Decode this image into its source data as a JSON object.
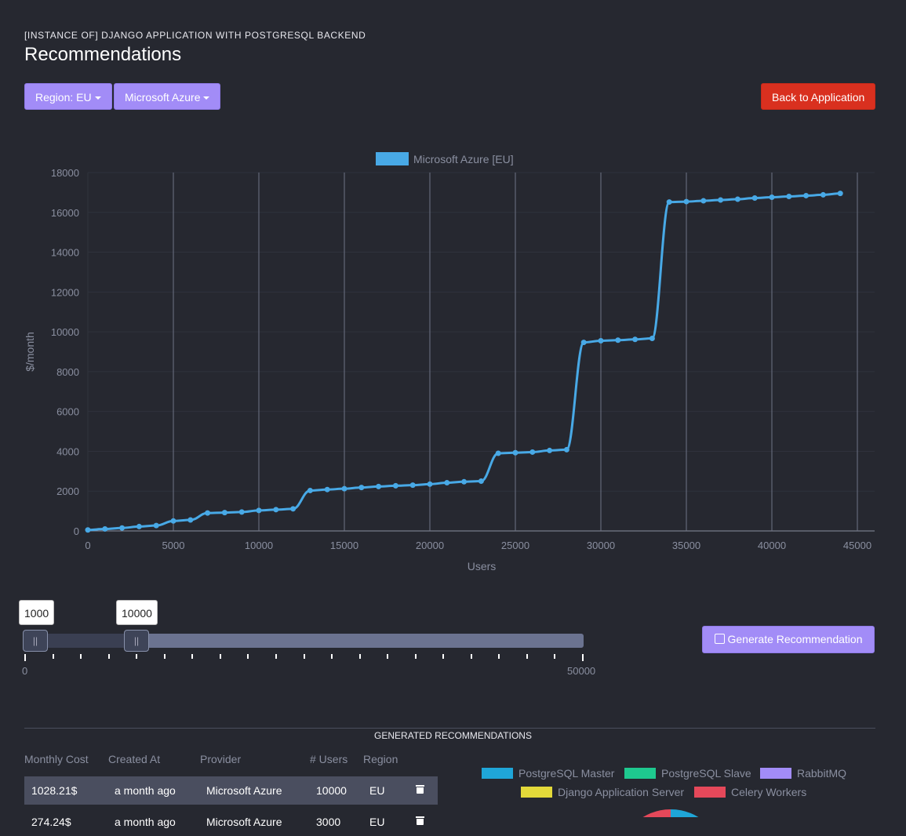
{
  "header": {
    "subtitle": "[INSTANCE OF] DJANGO APPLICATION WITH POSTGRESQL BACKEND",
    "title": "Recommendations"
  },
  "toolbar": {
    "region_label": "Region: EU",
    "provider_label": "Microsoft Azure",
    "back_label": "Back to Application"
  },
  "colors": {
    "accent_purple": "#a28cf7",
    "danger_red": "#d9301f",
    "series_blue": "#48a9e6",
    "background": "#262830"
  },
  "chart_data": {
    "type": "line",
    "legend": [
      "Microsoft Azure [EU]"
    ],
    "legend_position": "top",
    "xlabel": "Users",
    "ylabel": "$/month",
    "xlim": [
      0,
      45000
    ],
    "ylim": [
      0,
      18000
    ],
    "x_ticks": [
      "0",
      "5000",
      "10000",
      "15000",
      "20000",
      "25000",
      "30000",
      "35000",
      "40000",
      "45000"
    ],
    "y_ticks": [
      "0",
      "2000",
      "4000",
      "6000",
      "8000",
      "10000",
      "12000",
      "14000",
      "16000",
      "18000"
    ],
    "grid": true,
    "series": [
      {
        "name": "Microsoft Azure [EU]",
        "color": "#48a9e6",
        "x": [
          0,
          1000,
          2000,
          3000,
          4000,
          5000,
          6000,
          7000,
          8000,
          9000,
          10000,
          11000,
          12000,
          13000,
          14000,
          15000,
          16000,
          17000,
          18000,
          19000,
          20000,
          21000,
          22000,
          23000,
          24000,
          25000,
          26000,
          27000,
          28000,
          29000,
          30000,
          31000,
          32000,
          33000,
          34000,
          35000,
          36000,
          37000,
          38000,
          39000,
          40000,
          41000,
          42000,
          43000,
          44000
        ],
        "y": [
          50,
          100,
          150,
          220,
          270,
          500,
          550,
          900,
          920,
          950,
          1030,
          1070,
          1110,
          2030,
          2080,
          2120,
          2180,
          2230,
          2270,
          2300,
          2350,
          2420,
          2470,
          2500,
          3900,
          3930,
          3960,
          4040,
          4080,
          9470,
          9550,
          9580,
          9620,
          9670,
          16520,
          16540,
          16580,
          16620,
          16660,
          16720,
          16760,
          16800,
          16840,
          16880,
          16950
        ]
      }
    ]
  },
  "slider": {
    "low_value": "1000",
    "high_value": "10000",
    "min_label": "0",
    "max_label": "50000",
    "min": 0,
    "max": 50000,
    "low": 1000,
    "high": 10000
  },
  "generate_label": "Generate Recommendation",
  "recommendations": {
    "section_title": "GENERATED RECOMMENDATIONS",
    "columns": [
      "Monthly Cost",
      "Created At",
      "Provider",
      "# Users",
      "Region"
    ],
    "rows": [
      {
        "cost": "1028.21$",
        "created": "a month ago",
        "provider": "Microsoft Azure",
        "users": "10000",
        "region": "EU"
      },
      {
        "cost": "274.24$",
        "created": "a month ago",
        "provider": "Microsoft Azure",
        "users": "3000",
        "region": "EU"
      }
    ]
  },
  "pie_legend": [
    {
      "label": "PostgreSQL Master",
      "color": "#1fa6d8"
    },
    {
      "label": "PostgreSQL Slave",
      "color": "#1ec98f"
    },
    {
      "label": "RabbitMQ",
      "color": "#a28cf7"
    },
    {
      "label": "Django Application Server",
      "color": "#e3d93a"
    },
    {
      "label": "Celery Workers",
      "color": "#e5485a"
    }
  ]
}
